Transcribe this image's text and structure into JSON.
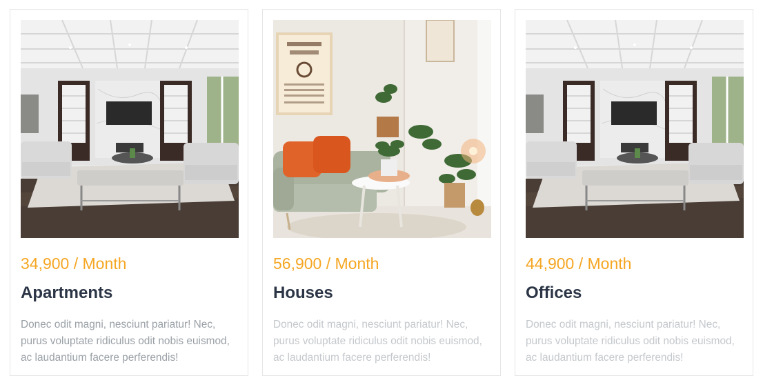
{
  "listings": [
    {
      "image": "living-room-photo",
      "price": "34,900 / Month",
      "title": "Apartments",
      "description": "Donec odit magni, nesciunt pariatur! Nec, purus voluptate ridiculus odit nobis euismod, ac laudantium facere perferendis!"
    },
    {
      "image": "cozy-corner-photo",
      "price": "56,900 / Month",
      "title": "Houses",
      "description": "Donec odit magni, nesciunt pariatur! Nec, purus voluptate ridiculus odit nobis euismod, ac laudantium facere perferendis!"
    },
    {
      "image": "living-room-photo",
      "price": "44,900 / Month",
      "title": "Offices",
      "description": "Donec odit magni, nesciunt pariatur! Nec, purus voluptate ridiculus odit nobis euismod, ac laudantium facere perferendis!"
    }
  ],
  "colors": {
    "price": "#f5a623",
    "title": "#2b3545",
    "description": "#9aa0a6",
    "card_border": "#e6e6e6"
  }
}
